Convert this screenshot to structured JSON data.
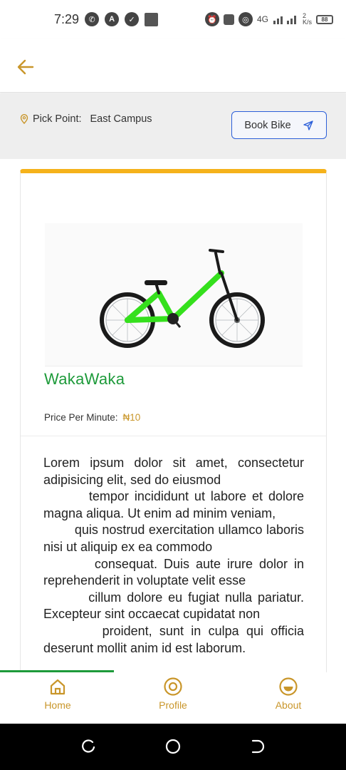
{
  "status_bar": {
    "time": "7:29",
    "icons": [
      "whatsapp-icon",
      "app-icon",
      "shield-icon",
      "notification-icon",
      "alarm-icon",
      "vibrate-icon",
      "hotspot-icon",
      "signal-icon",
      "signal-icon",
      "data-speed-icon",
      "battery-icon"
    ],
    "network": "4G",
    "data_speed": "2",
    "data_speed_unit": "K/s",
    "battery": "88"
  },
  "header": {
    "back_icon": "arrow-left-icon"
  },
  "pick_point": {
    "label": "Pick Point:",
    "value": "East Campus",
    "icon": "location-pin-icon"
  },
  "book_button": {
    "label": "Book Bike",
    "icon": "send-icon"
  },
  "bike": {
    "name": "WakaWaka",
    "price_label": "Price Per Minute:",
    "price_value": "₦10",
    "description": "Lorem ipsum dolor sit amet, consectetur adipisicing elit, sed do eiusmod\n        tempor incididunt ut labore et dolore magna aliqua. Ut enim ad minim veniam,\n        quis nostrud exercitation ullamco laboris nisi ut aliquip ex ea commodo\n        consequat. Duis aute irure dolor in reprehenderit in voluptate velit esse\n        cillum dolore eu fugiat nulla pariatur. Excepteur sint occaecat cupidatat non\n        proident, sunt in culpa qui officia deserunt mollit anim id est laborum."
  },
  "progress": {
    "fraction": 0.33
  },
  "nav": [
    {
      "label": "Home",
      "icon": "home-icon"
    },
    {
      "label": "Profile",
      "icon": "profile-icon"
    },
    {
      "label": "About",
      "icon": "about-icon"
    }
  ],
  "system_nav": [
    "recent-apps-icon",
    "home-circle-icon",
    "back-icon"
  ],
  "colors": {
    "accent": "#c9962a",
    "brand_green": "#1d9a3a",
    "card_top": "#f5b21b",
    "button_border": "#2b5fd9"
  }
}
